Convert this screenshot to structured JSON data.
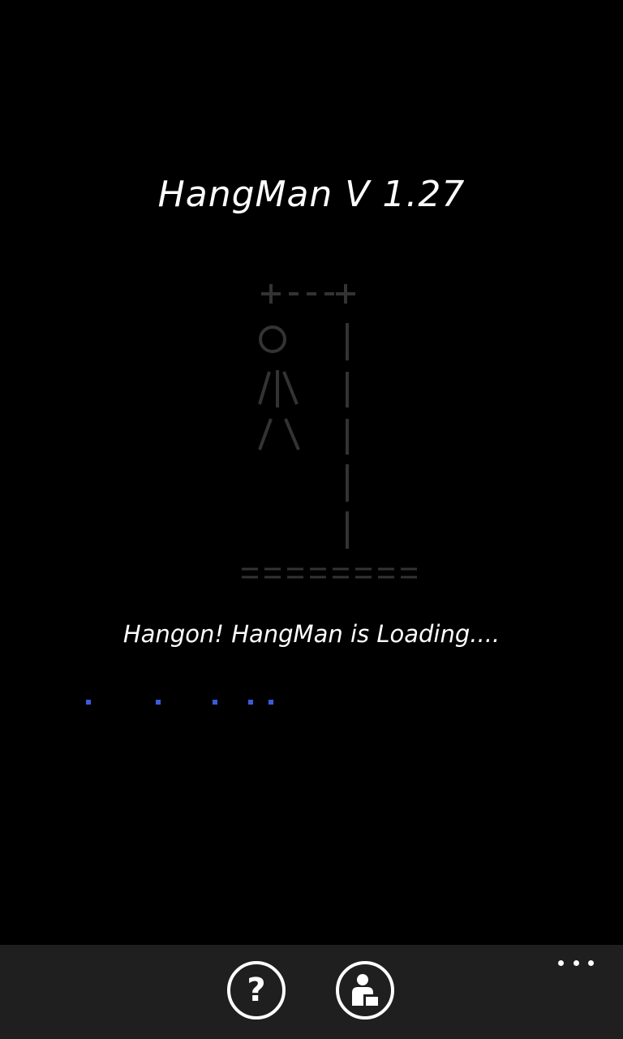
{
  "title": "HangMan V 1.27",
  "loading_text": "Hangon! HangMan is Loading....",
  "gallows_ascii": {
    "row1": "+---+",
    "row2": "O   |",
    "row3": "/|\\  |",
    "row4": "/ \\  |",
    "row5": "|",
    "row6": "|",
    "base": "========"
  },
  "progress": {
    "color": "#3b5bdb",
    "dot_count": 5
  },
  "app_bar": {
    "background": "#1f1f1f",
    "buttons": [
      {
        "name": "help",
        "icon": "question-mark-icon",
        "glyph": "?"
      },
      {
        "name": "profile",
        "icon": "person-icon"
      }
    ],
    "more_icon": "ellipsis-icon"
  }
}
